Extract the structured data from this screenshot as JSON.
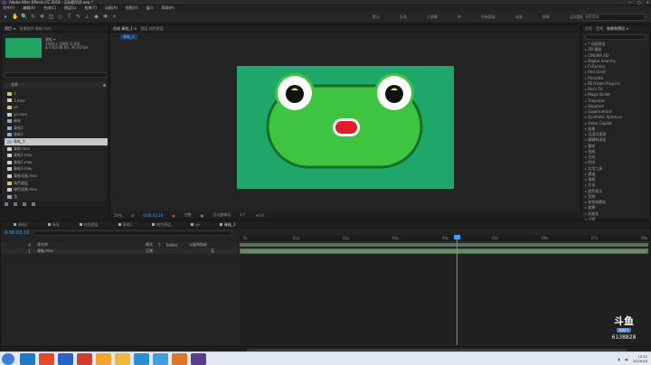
{
  "window": {
    "title": "Adobe After Effects CC 2018 - 无标题项目.aep *",
    "buttons": [
      "—",
      "□",
      "✕"
    ]
  },
  "menu": [
    "文件(F)",
    "编辑(E)",
    "合成(C)",
    "图层(L)",
    "效果(T)",
    "动画(A)",
    "视图(V)",
    "窗口",
    "帮助(H)"
  ],
  "tools": [
    "▸",
    "✋",
    "🔍",
    "↻",
    "✥",
    "◫",
    "◇",
    "T",
    "✎",
    "⊥",
    "◆",
    "✚",
    "⌖"
  ],
  "workspaces": [
    "默认",
    "标准",
    "小屏幕",
    "库",
    "所有面板",
    "动画",
    "效果",
    "运动跟踪",
    "绘画"
  ],
  "search_placeholder": "搜索帮助",
  "project": {
    "tabs": [
      "项目 ≡",
      "效果控件 青蛙.mov"
    ],
    "thumb_info": [
      "青蛙 ▾",
      "1920 x 1080 (1.00)",
      "Δ 0:00:08:00, 30.00 fps"
    ],
    "column_name": "名称",
    "items": [
      {
        "name": "1",
        "type": "folder"
      },
      {
        "name": "2.mov",
        "type": "file"
      },
      {
        "name": "ye",
        "type": "folder"
      },
      {
        "name": "ye.mov",
        "type": "file"
      },
      {
        "name": "青蛙",
        "type": "comp"
      },
      {
        "name": "青蛙2",
        "type": "comp"
      },
      {
        "name": "青蛙3",
        "type": "comp"
      },
      {
        "name": "青蛙_1",
        "type": "comp",
        "selected": true
      },
      {
        "name": "青蛙.mov",
        "type": "file"
      },
      {
        "name": "青蛙1.mov",
        "type": "file"
      },
      {
        "name": "青蛙2.mov",
        "type": "file"
      },
      {
        "name": "青蛙3.mov",
        "type": "file"
      },
      {
        "name": "青蛙动画.mov",
        "type": "file"
      },
      {
        "name": "纯色图层",
        "type": "folder"
      },
      {
        "name": "绿色背景.mov",
        "type": "file"
      },
      {
        "name": "龙",
        "type": "comp"
      },
      {
        "name": "龙.mov",
        "type": "file"
      }
    ]
  },
  "viewer": {
    "tabs": [
      "合成 青蛙_1 ≡",
      "图层 纯色图层"
    ],
    "breadcrumb": "青蛙_1",
    "footer": [
      "50%",
      "⊞",
      "0:00:03:19",
      "◉",
      "完整",
      "▣",
      "活动摄像机",
      "1个",
      "+0.0"
    ]
  },
  "effects": {
    "tabs": [
      "信息",
      "音频",
      "效果和预设 ≡"
    ],
    "items": [
      "* 动画预设",
      "3D 通道",
      "CINEMA 4D",
      "Digital Anarchy",
      "FxFactory",
      "Red Giant",
      "Primatte",
      "RE:Vision Plug-ins",
      "Boris FX",
      "Magic Bullet",
      "Trapcode",
      "Sapphire",
      "Superluminal",
      "Synthetic Aperture",
      "Video Copilot",
      "抠像",
      "沉浸式视频",
      "模糊和锐化",
      "模拟",
      "扭曲",
      "生成",
      "时间",
      "实用工具",
      "通道",
      "透视",
      "文本",
      "颜色校正",
      "音频",
      "杂色和颗粒",
      "遮罩",
      "风格化",
      "过渡"
    ]
  },
  "timeline": {
    "tabs": [
      "青蛙2",
      "青蛙",
      "纯色图层",
      "青蛙3",
      "纯色图层",
      "ye",
      "青蛙_1"
    ],
    "active_tab": 6,
    "timecode": "0:00:03:19",
    "layer_columns": [
      "#",
      "源名称",
      "模式",
      "T",
      "TrkMat",
      "父级和链接"
    ],
    "layer": {
      "num": "1",
      "name": "青蛙.mov",
      "mode": "正常",
      "parent": "无"
    },
    "ruler": [
      "0s",
      "01s",
      "02s",
      "03s",
      "04s",
      "05s",
      "06s",
      "07s",
      "08s"
    ],
    "playhead_fraction": 0.53
  },
  "watermark": {
    "logo": "斗鱼",
    "sub": "搜图号",
    "id": "6138828"
  },
  "taskbar": {
    "apps": [
      "#1f7ac2",
      "#e8472a",
      "#2a62c9",
      "#d03c2e",
      "#f4a62a",
      "#f0b93c",
      "#2a8fd0",
      "#3f9fe0",
      "#e0742b",
      "#5a3c8c"
    ],
    "time": "10:32",
    "date": "2019/9/4"
  }
}
